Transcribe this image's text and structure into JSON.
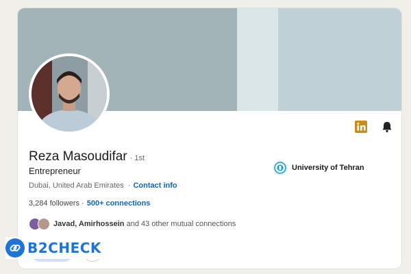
{
  "profile": {
    "name": "Reza Masoudifar",
    "degree": "· 1st",
    "headline": "Entrepreneur",
    "location": "Dubai, United Arab Emirates",
    "contact_sep": "·",
    "contact_label": "Contact info",
    "followers": "3,284 followers ·",
    "connections": "500+ connections",
    "mutual_names": "Javad, Amirhossein",
    "mutual_rest": " and 43 other mutual connections"
  },
  "education": {
    "name": "University of Tehran"
  },
  "icons": {
    "linkedin": "linkedin-icon",
    "bell": "bell-icon",
    "university": "university-logo-icon"
  },
  "watermark": {
    "text": "B2CHECK"
  },
  "colors": {
    "link": "#0a66c2",
    "banner": "#bfd1d6",
    "brand_watermark": "#1e73d6"
  }
}
